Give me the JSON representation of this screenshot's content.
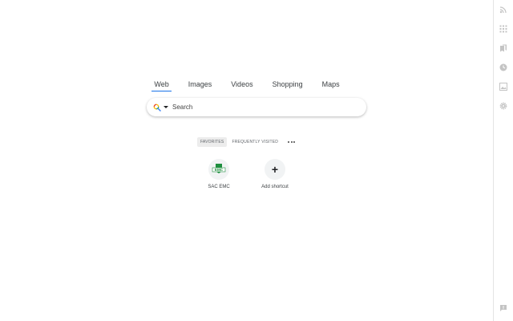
{
  "search_tabs": [
    {
      "label": "Web",
      "active": true
    },
    {
      "label": "Images",
      "active": false
    },
    {
      "label": "Videos",
      "active": false
    },
    {
      "label": "Shopping",
      "active": false
    },
    {
      "label": "Maps",
      "active": false
    }
  ],
  "search": {
    "placeholder": "Search",
    "engine_icon": "search-engine-icon",
    "value": ""
  },
  "shortcut_filters": [
    {
      "label": "FAVORITES",
      "active": true
    },
    {
      "label": "FREQUENTLY VISITED",
      "active": false
    }
  ],
  "shortcuts": [
    {
      "label": "SAC EMC",
      "icon": "site-favicon",
      "favicon_text": "EMC"
    },
    {
      "label": "Add shortcut",
      "icon": "plus-icon",
      "glyph": "+"
    }
  ],
  "rail_icons": [
    "rss-feed-icon",
    "apps-grid-icon",
    "bookmarks-icon",
    "history-icon",
    "image-icon",
    "settings-gear-icon",
    "feedback-icon"
  ],
  "colors": {
    "accent": "#1a73e8",
    "rail_icon": "#c4c4c4",
    "favicon_green": "#1e8e3e"
  }
}
